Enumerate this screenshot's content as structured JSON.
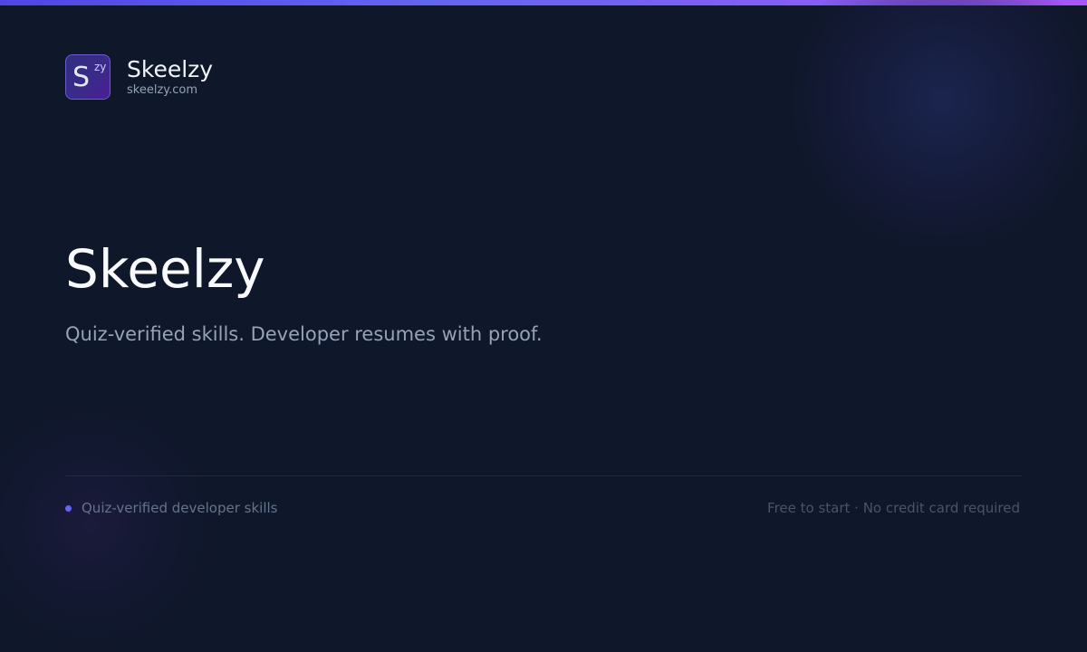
{
  "colors": {
    "background": "#0f172a",
    "accent": "#6366f1",
    "accent_purple": "#a855f7"
  },
  "brand": {
    "logo_letter": "S",
    "logo_superscript": "zy",
    "name": "Skeelzy",
    "domain": "skeelzy.com"
  },
  "hero": {
    "title": "Skeelzy",
    "tagline": "Quiz-verified skills. Developer resumes with proof."
  },
  "footer": {
    "left_text": "Quiz-verified developer skills",
    "right_text": "Free to start · No credit card required"
  }
}
